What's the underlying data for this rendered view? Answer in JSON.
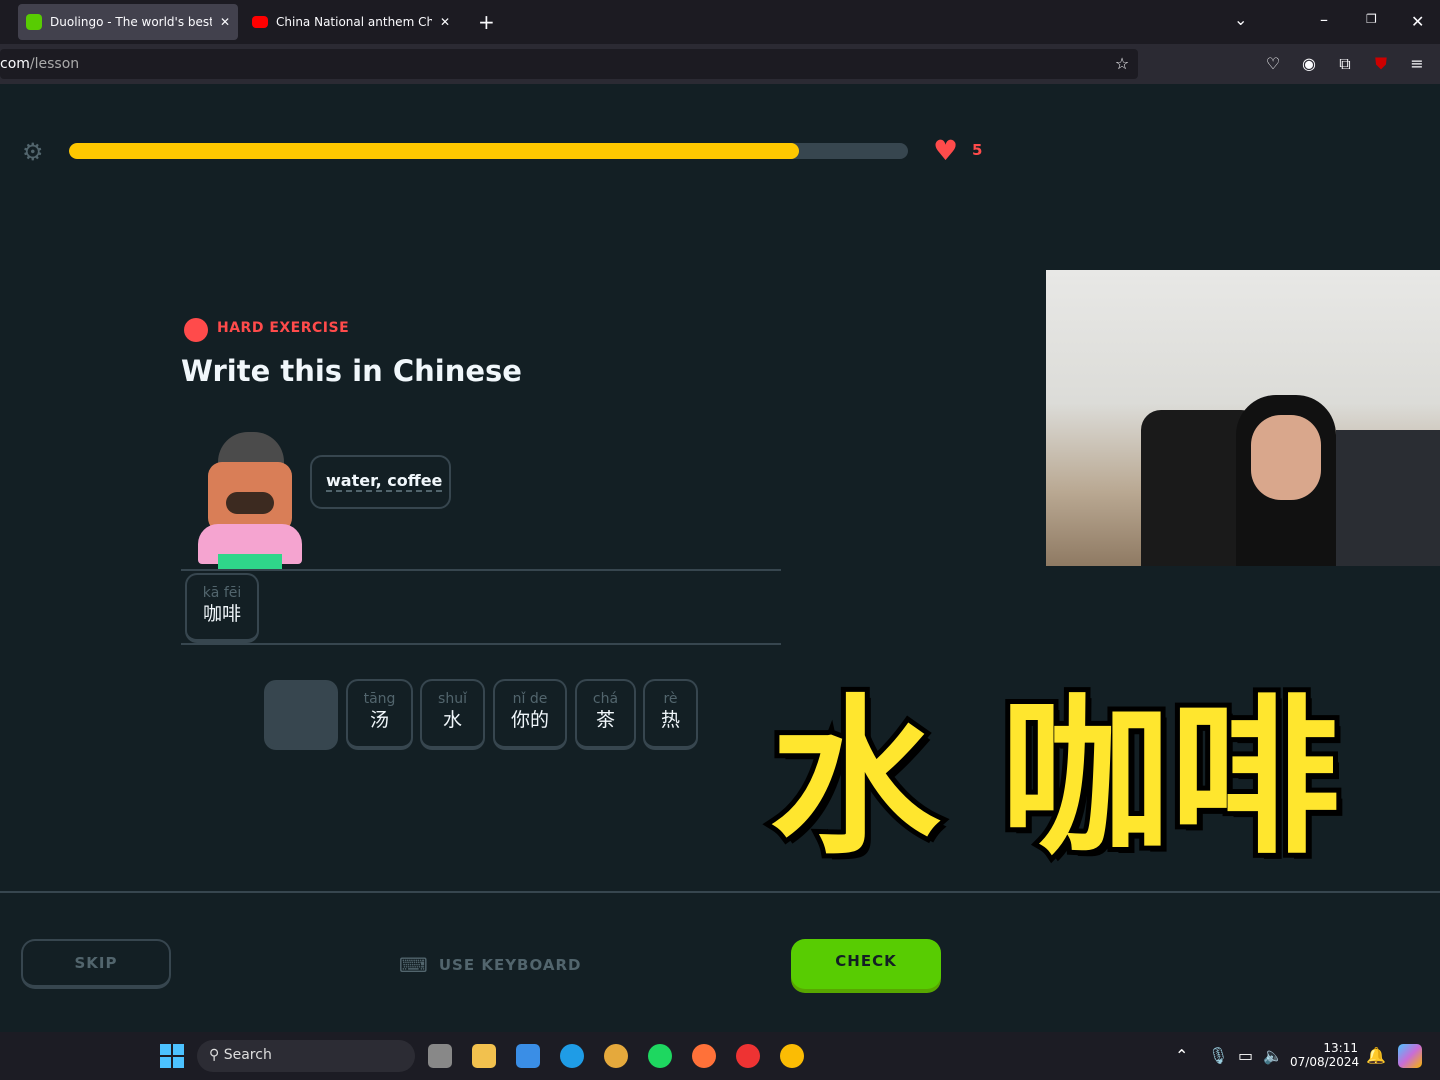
{
  "browser": {
    "tabs": [
      {
        "title": "Duolingo - The world's best wa",
        "active": true
      },
      {
        "title": "China National anthem Chinese",
        "active": false
      }
    ],
    "url_domain": "com",
    "url_path": "/lesson",
    "new_tab": "+"
  },
  "lesson": {
    "progress_percent": 87,
    "hearts": "5",
    "badge": "HARD EXERCISE",
    "title": "Write this in Chinese",
    "prompt": "water, coffee",
    "answer_tiles": [
      {
        "pinyin": "kā fēi",
        "hanzi": "咖啡"
      }
    ],
    "word_bank": [
      {
        "pinyin": "tāng",
        "hanzi": "汤"
      },
      {
        "pinyin": "shuǐ",
        "hanzi": "水"
      },
      {
        "pinyin": "nǐ de",
        "hanzi": "你的"
      },
      {
        "pinyin": "chá",
        "hanzi": "茶"
      },
      {
        "pinyin": "rè",
        "hanzi": "热"
      }
    ],
    "skip": "SKIP",
    "use_keyboard": "USE KEYBOARD",
    "check": "CHECK"
  },
  "overlay": {
    "left": "水",
    "right": "咖啡"
  },
  "taskbar": {
    "search": "Search",
    "time": "13:11",
    "date": "07/08/2024"
  },
  "colors": {
    "accent": "#58cc02",
    "progress": "#ffc800",
    "heart": "#ff4b4b",
    "background": "#131f24"
  }
}
